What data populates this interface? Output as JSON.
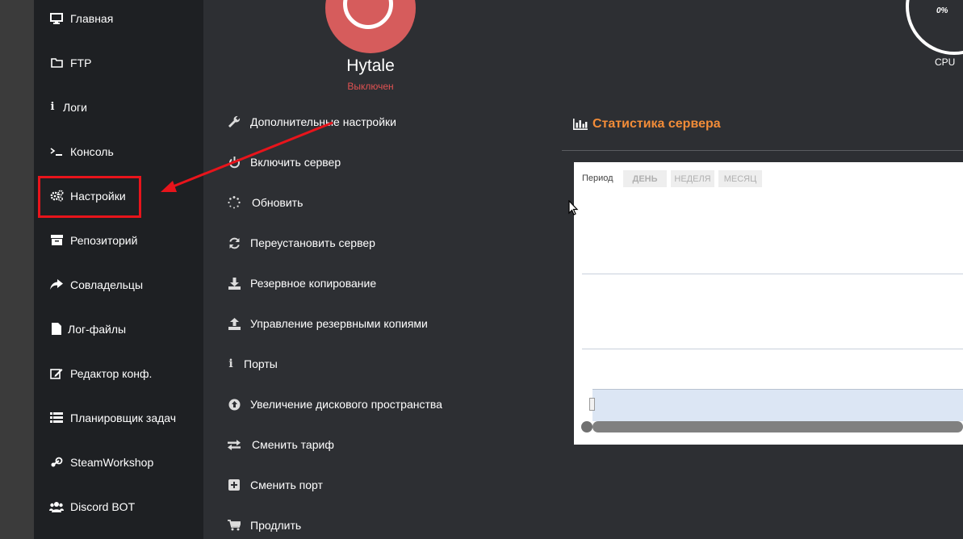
{
  "sidebar": {
    "items": [
      {
        "label": "Главная",
        "icon": "monitor-icon"
      },
      {
        "label": "FTP",
        "icon": "folder-icon"
      },
      {
        "label": "Логи",
        "icon": "info-icon"
      },
      {
        "label": "Консоль",
        "icon": "terminal-icon"
      },
      {
        "label": "Настройки",
        "icon": "gears-icon"
      },
      {
        "label": "Репозиторий",
        "icon": "archive-icon"
      },
      {
        "label": "Совладельцы",
        "icon": "share-icon"
      },
      {
        "label": "Лог-файлы",
        "icon": "file-icon"
      },
      {
        "label": "Редактор конф.",
        "icon": "edit-icon"
      },
      {
        "label": "Планировщик задач",
        "icon": "list-icon"
      },
      {
        "label": "SteamWorkshop",
        "icon": "steam-icon"
      },
      {
        "label": "Discord BOT",
        "icon": "users-icon"
      }
    ]
  },
  "server": {
    "name": "Hytale",
    "status": "Выключен",
    "status_color": "#e05252"
  },
  "menu": {
    "items": [
      {
        "label": "Дополнительные настройки",
        "icon": "wrench-icon"
      },
      {
        "label": "Включить сервер",
        "icon": "power-icon"
      },
      {
        "label": "Обновить",
        "icon": "spinner-icon"
      },
      {
        "label": "Переустановить сервер",
        "icon": "refresh-icon"
      },
      {
        "label": "Резервное копирование",
        "icon": "download-icon"
      },
      {
        "label": "Управление резервными копиями",
        "icon": "upload-icon"
      },
      {
        "label": "Порты",
        "icon": "info-icon"
      },
      {
        "label": "Увеличение дискового пространства",
        "icon": "arrow-up-circle-icon"
      },
      {
        "label": "Сменить тариф",
        "icon": "exchange-icon"
      },
      {
        "label": "Сменить порт",
        "icon": "plus-square-icon"
      },
      {
        "label": "Продлить",
        "icon": "cart-icon"
      }
    ]
  },
  "stats": {
    "title": "Статистика сервера",
    "period_label": "Период",
    "periods": [
      "ДЕНЬ",
      "НЕДЕЛЯ",
      "МЕСЯЦ"
    ],
    "accent_color": "#f28c38"
  },
  "cpu": {
    "value": "0%",
    "label": "CPU"
  },
  "colors": {
    "highlight": "#e8141b",
    "power_button": "#d65c5c"
  }
}
